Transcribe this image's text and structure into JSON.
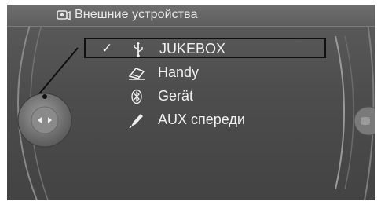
{
  "header": {
    "title": "Внешние устройства",
    "icon": "devices-icon"
  },
  "menu": {
    "items": [
      {
        "label": "JUKEBOX",
        "icon": "usb-icon",
        "checked": true,
        "selected": true
      },
      {
        "label": "Handy",
        "icon": "phone-icon",
        "checked": false,
        "selected": false
      },
      {
        "label": "Gerät",
        "icon": "bluetooth-icon",
        "checked": false,
        "selected": false
      },
      {
        "label": "AUX спереди",
        "icon": "aux-pen-icon",
        "checked": false,
        "selected": false
      }
    ],
    "check_mark": "✓"
  },
  "controller": {
    "icon": "controller-knob-icon"
  },
  "colors": {
    "background": "#4f4f4f",
    "text": "#efefef",
    "selection_border": "#0f0f0f"
  }
}
